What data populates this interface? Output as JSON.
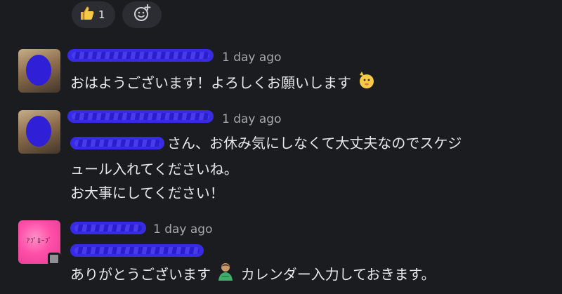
{
  "reactions": {
    "thumbs_up_count": "1"
  },
  "messages": [
    {
      "timestamp": "1 day ago",
      "text": "おはようございます！よろしくお願いします"
    },
    {
      "timestamp": "1 day ago",
      "text_line1": "さん、お休み気にしなくて大丈夫なのでスケジ",
      "text_line2": "ュール入れてくださいね。",
      "text_line3": "お大事にしてください！"
    },
    {
      "timestamp": "1 day ago",
      "text_part1": "ありがとうございます",
      "text_part2": "カレンダー入力しておきます。"
    }
  ],
  "colors": {
    "background": "#1b1c20",
    "text": "#e8e8ea",
    "timestamp": "#a8a8ad",
    "redaction": "#3a2cf0"
  },
  "icons": [
    "thumbs-up-icon",
    "add-reaction-icon",
    "waving-hand-emoji-icon",
    "person-bowing-emoji-icon"
  ]
}
